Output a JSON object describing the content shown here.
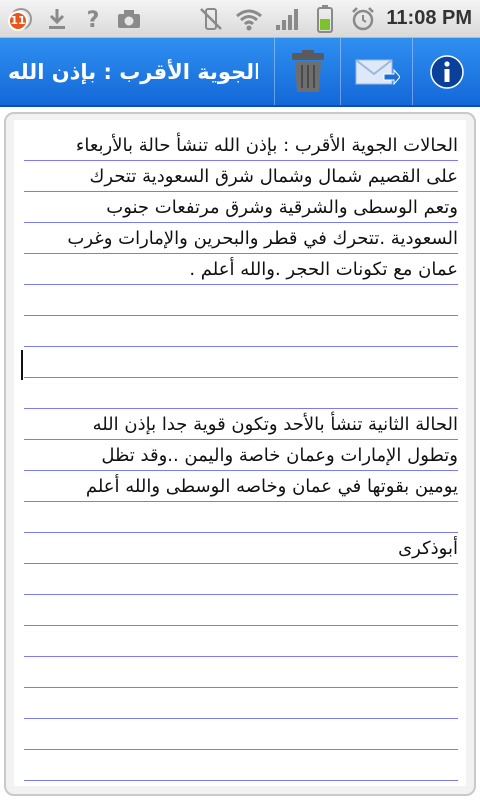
{
  "status_bar": {
    "notification_count": "11",
    "time": "11:08 PM",
    "icons": [
      "notification-badge-icon",
      "download-icon",
      "help-icon",
      "camera-icon",
      "vibrate-off-icon",
      "wifi-icon",
      "signal-icon",
      "battery-icon",
      "alarm-icon"
    ]
  },
  "action_bar": {
    "title": "الحالات الجوية الأقرب : بإذن الله",
    "buttons": [
      "delete-button",
      "send-button",
      "info-button"
    ]
  },
  "note": {
    "lines": [
      "الحالات الجوية الأقرب : بإذن الله تنشأ حالة بالأربعاء",
      "على القصيم شمال وشمال شرق السعودية تتحرك",
      "وتعم الوسطى والشرقية وشرق مرتفعات جنوب",
      "السعودية .تتحرك في قطر والبحرين والإمارات وغرب",
      "عمان مع تكونات الحجر .والله أعلم .",
      "",
      "",
      "",
      "",
      "الحالة الثانية تنشأ بالأحد وتكون قوية جدا بإذن الله",
      "وتطول الإمارات وعمان خاصة واليمن ..وقد تظل",
      "يومين بقوتها في عمان وخاصه الوسطى والله أعلم",
      "",
      "أبوذكرى"
    ]
  },
  "colors": {
    "action_bar": "#1a73e0",
    "rule_line": "#7c7cf0",
    "badge": "#e8561c"
  }
}
